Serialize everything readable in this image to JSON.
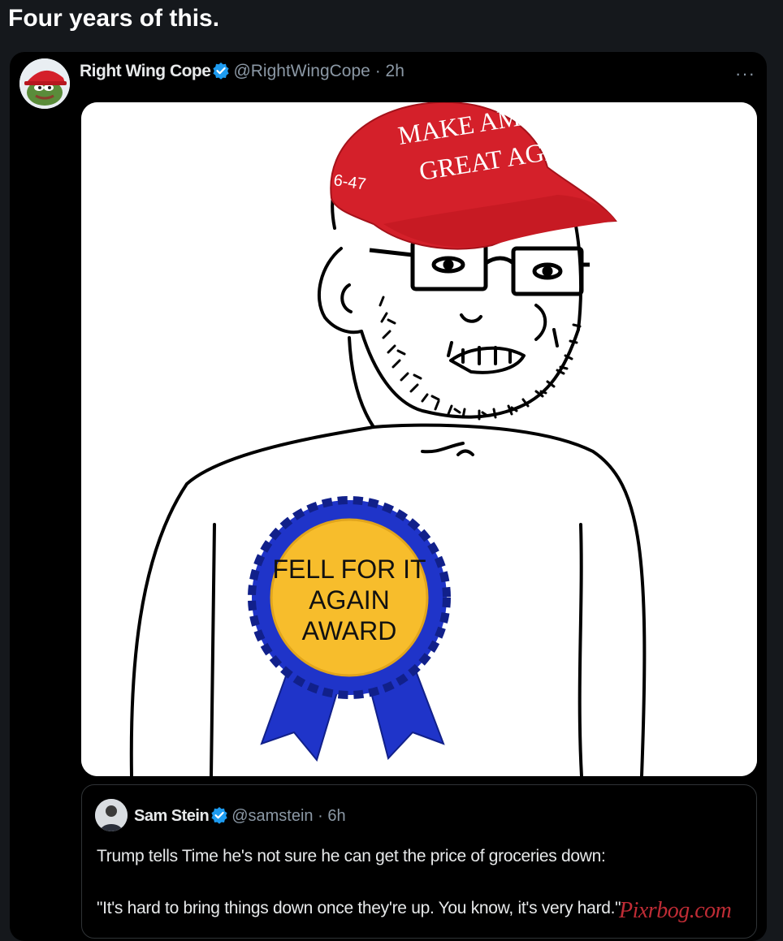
{
  "post": {
    "title": "Four years of this."
  },
  "tweet": {
    "display_name": "Right Wing Cope",
    "handle": "@RightWingCope",
    "separator": "·",
    "time": "2h",
    "avatar_icon": "pepe-maga-avatar-icon",
    "more_icon": "more-options-icon",
    "more_label": "···"
  },
  "meme": {
    "hat_line1": "MAKE AMERI",
    "hat_line2": "GREAT AGAI",
    "hat_side": "6-47",
    "award_line1": "FELL FOR IT",
    "award_line2": "AGAIN",
    "award_line3": "AWARD"
  },
  "quote": {
    "display_name": "Sam Stein",
    "handle": "@samstein",
    "separator": "·",
    "time": "6h",
    "text_line1": "Trump tells Time he's not sure he can get the price of groceries down:",
    "text_line2": "\"It's hard to bring things down once they're up. You know, it's very hard.\""
  },
  "watermark": "Pixrbog.com",
  "colors": {
    "background": "#15181c",
    "card": "#000000",
    "verified": "#1d9bf0",
    "hat_red": "#d4202a",
    "ribbon_blue": "#1f34c9",
    "medal_gold": "#f7bd2c",
    "watermark_red": "#d0303a"
  }
}
